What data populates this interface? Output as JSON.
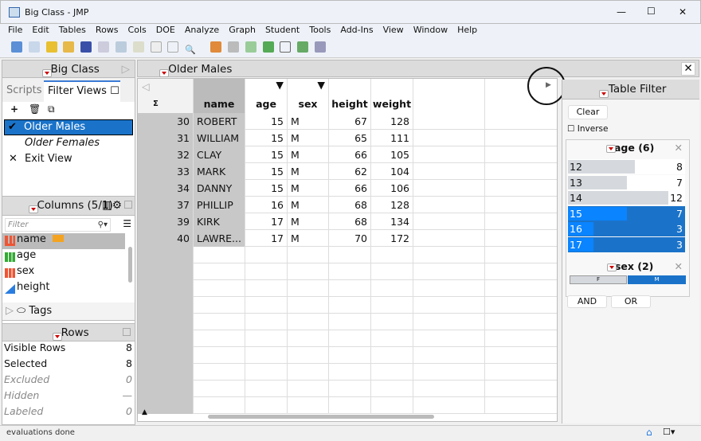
{
  "window": {
    "title": "Big Class - JMP",
    "minimize": "—",
    "maximize": "☐",
    "close": "✕"
  },
  "menu": [
    "File",
    "Edit",
    "Tables",
    "Rows",
    "Cols",
    "DOE",
    "Analyze",
    "Graph",
    "Student",
    "Tools",
    "Add-Ins",
    "View",
    "Window",
    "Help"
  ],
  "left": {
    "table_title": "Big Class",
    "tabs": [
      "Scripts",
      "Filter Views"
    ],
    "views": [
      {
        "label": "Older Males",
        "selected": true
      },
      {
        "label": "Older Females"
      },
      {
        "label": "Exit View"
      }
    ],
    "columns_title": "Columns (5/1)",
    "filter_placeholder": "Filter",
    "columns": [
      {
        "name": "name",
        "type": "nominal"
      },
      {
        "name": "age",
        "type": "ordinal"
      },
      {
        "name": "sex",
        "type": "nominal"
      },
      {
        "name": "height",
        "type": "continuous"
      }
    ],
    "tags_label": "Tags",
    "rows_title": "Rows",
    "rows_stats": [
      {
        "label": "Visible Rows",
        "value": "8"
      },
      {
        "label": "Selected",
        "value": "8"
      },
      {
        "label": "Excluded",
        "value": "0",
        "dim": true
      },
      {
        "label": "Hidden",
        "value": "—",
        "dim": true
      },
      {
        "label": "Labeled",
        "value": "0",
        "dim": true
      }
    ]
  },
  "main": {
    "title": "Older Males",
    "headers": [
      "name",
      "age",
      "sex",
      "height",
      "weight"
    ],
    "rows": [
      [
        "30",
        "ROBERT",
        "15",
        "M",
        "67",
        "128"
      ],
      [
        "31",
        "WILLIAM",
        "15",
        "M",
        "65",
        "111"
      ],
      [
        "32",
        "CLAY",
        "15",
        "M",
        "66",
        "105"
      ],
      [
        "33",
        "MARK",
        "15",
        "M",
        "62",
        "104"
      ],
      [
        "34",
        "DANNY",
        "15",
        "M",
        "66",
        "106"
      ],
      [
        "37",
        "PHILLIP",
        "16",
        "M",
        "68",
        "128"
      ],
      [
        "39",
        "KIRK",
        "17",
        "M",
        "68",
        "134"
      ],
      [
        "40",
        "LAWRE...",
        "17",
        "M",
        "70",
        "172"
      ]
    ]
  },
  "filter": {
    "title": "Table Filter",
    "clear": "Clear",
    "inverse": "Inverse",
    "age_title": "age (6)",
    "age_levels": [
      {
        "level": "12",
        "count": 8,
        "selected": false
      },
      {
        "level": "13",
        "count": 7,
        "selected": false
      },
      {
        "level": "14",
        "count": 12,
        "selected": false
      },
      {
        "level": "15",
        "count": 7,
        "selected": true
      },
      {
        "level": "16",
        "count": 3,
        "selected": true
      },
      {
        "level": "17",
        "count": 3,
        "selected": true
      }
    ],
    "sex_title": "sex (2)",
    "sex_levels": [
      {
        "level": "F",
        "selected": false
      },
      {
        "level": "M",
        "selected": true
      }
    ],
    "and": "AND",
    "or": "OR"
  },
  "status": {
    "text": "evaluations done"
  },
  "colors": {
    "selected": "#1a73c9",
    "bright": "#0a84ff",
    "bar": "#d5d9de"
  }
}
